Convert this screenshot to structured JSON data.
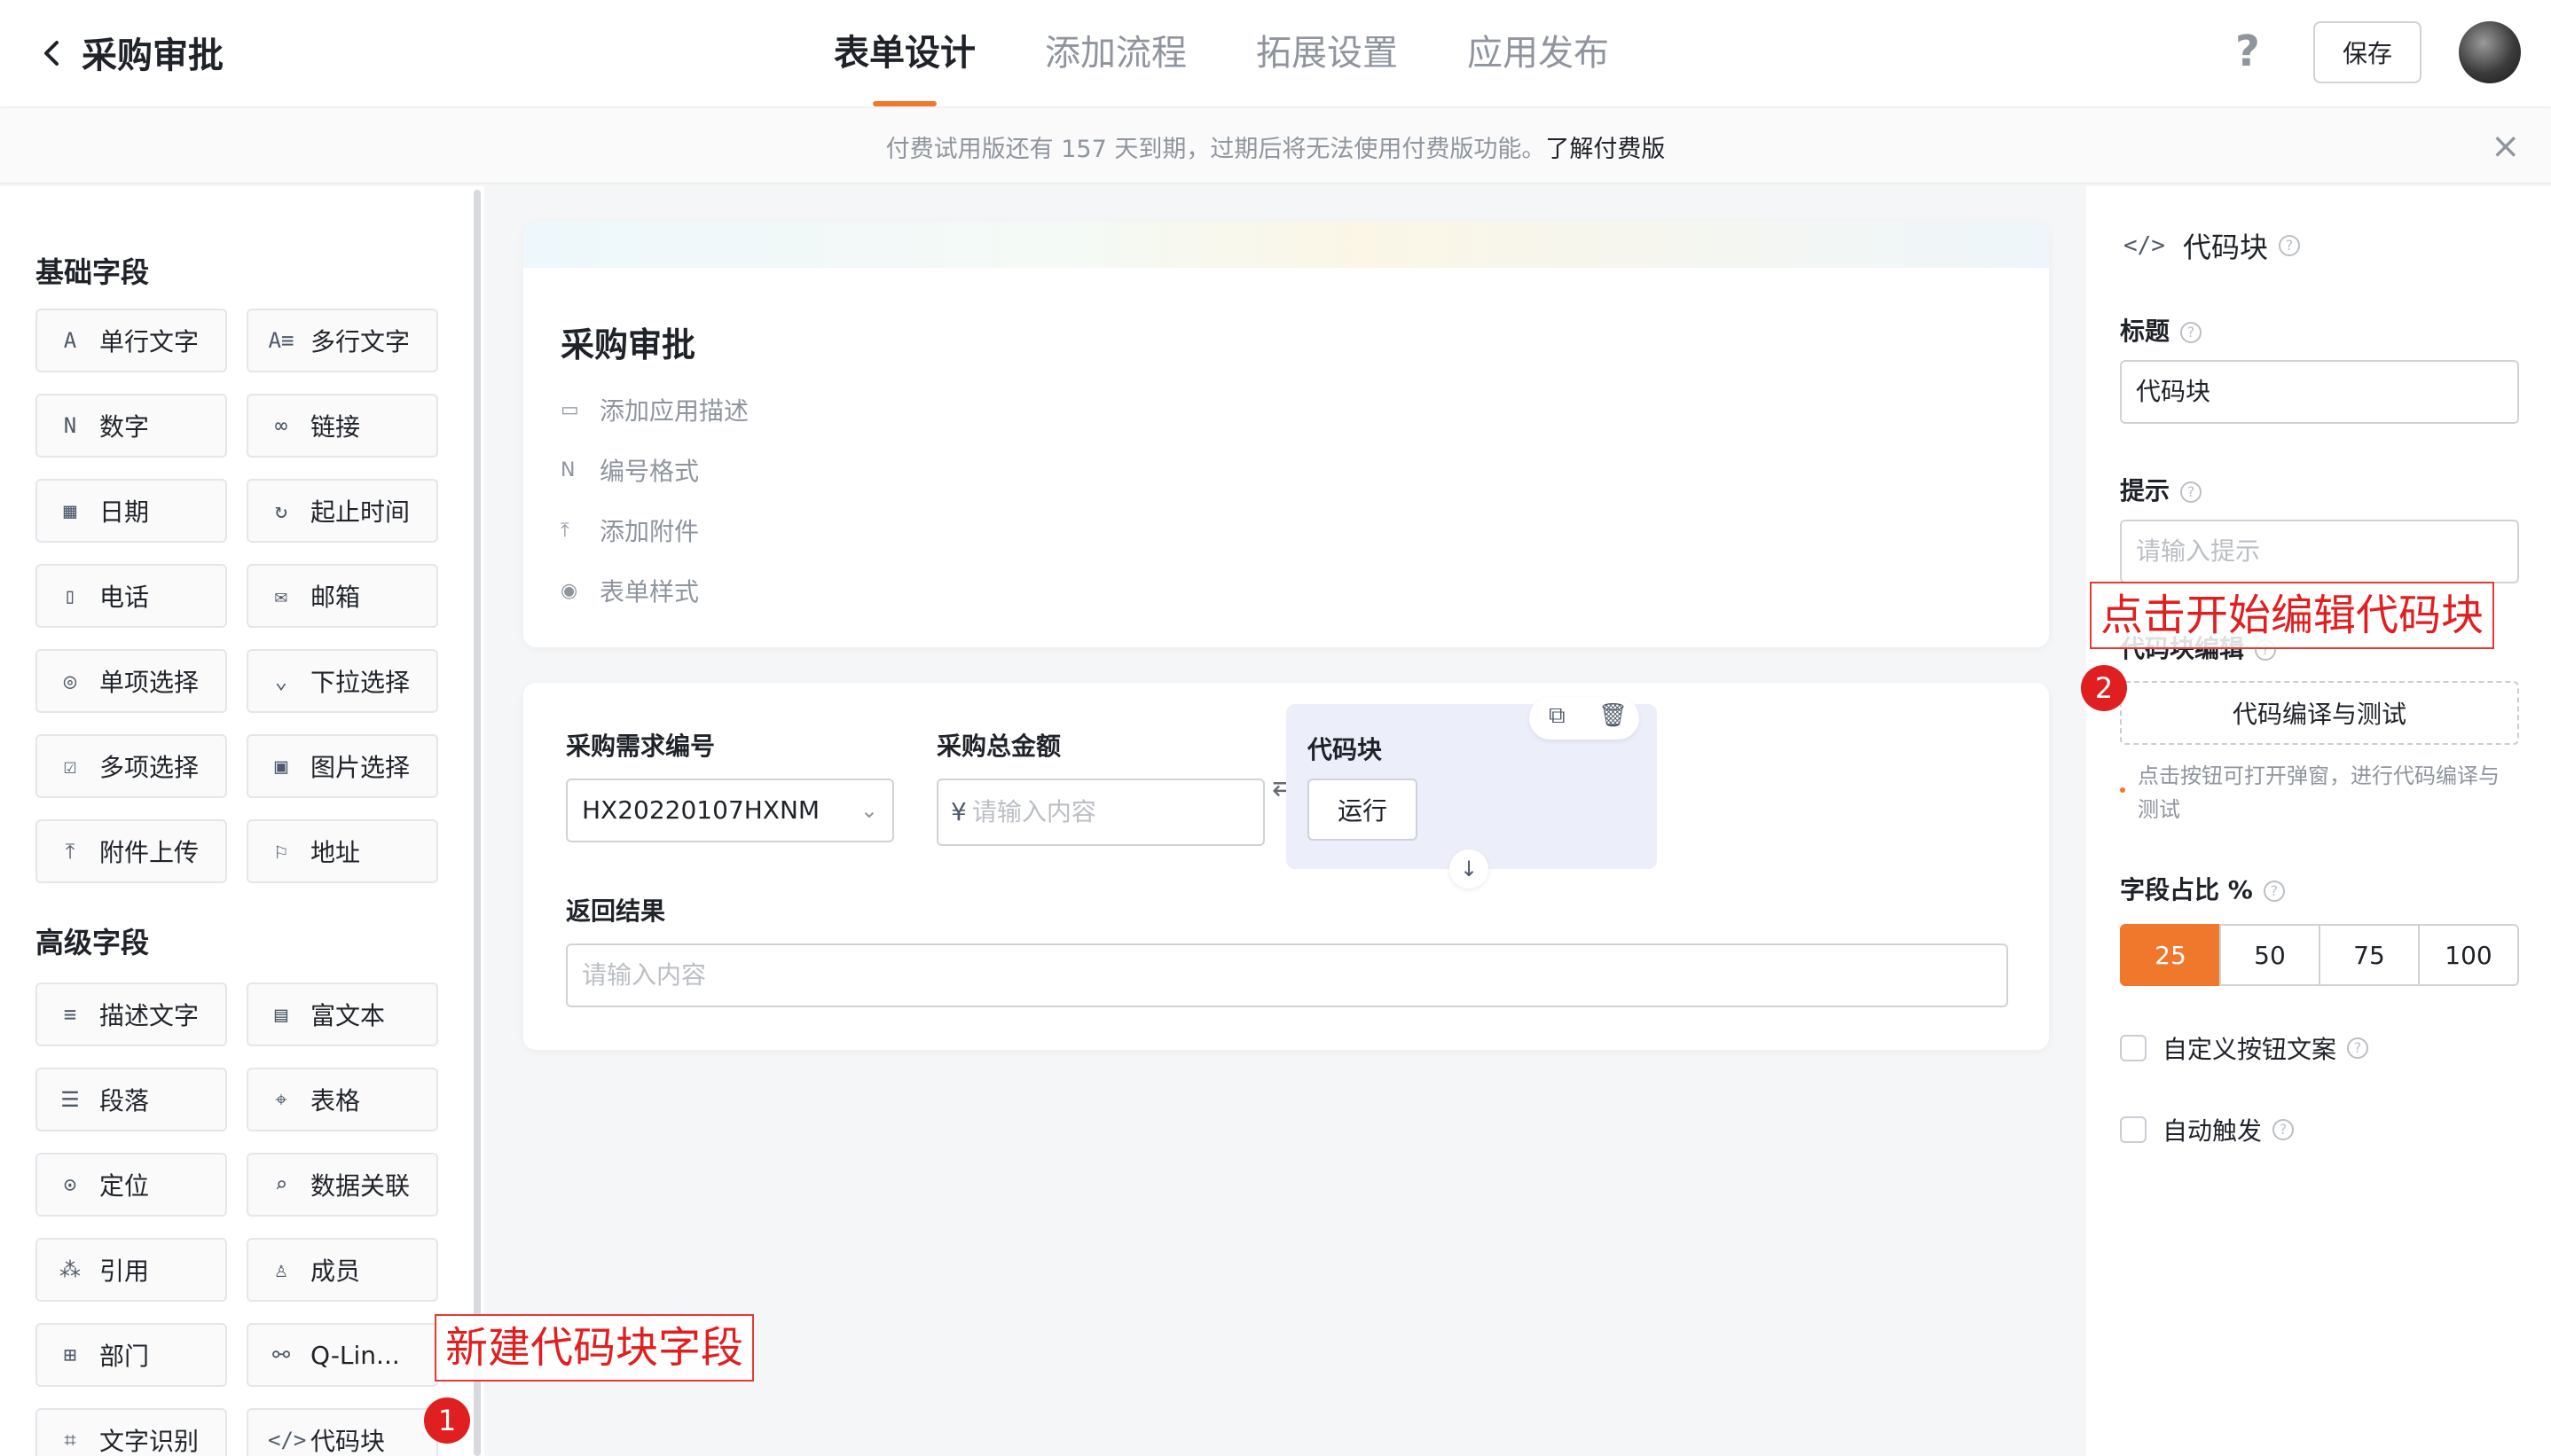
{
  "header": {
    "title": "采购审批",
    "tabs": [
      {
        "label": "表单设计",
        "active": true
      },
      {
        "label": "添加流程",
        "active": false
      },
      {
        "label": "拓展设置",
        "active": false
      },
      {
        "label": "应用发布",
        "active": false
      }
    ],
    "help": "?",
    "save_label": "保存"
  },
  "banner": {
    "text": "付费试用版还有 157 天到期，过期后将无法使用付费版功能。",
    "link": "了解付费版",
    "close": "×"
  },
  "left": {
    "basic_title": "基础字段",
    "basic": [
      {
        "icon": "A",
        "label": "单行文字"
      },
      {
        "icon": "A≡",
        "label": "多行文字"
      },
      {
        "icon": "N",
        "label": "数字"
      },
      {
        "icon": "∞",
        "label": "链接"
      },
      {
        "icon": "▦",
        "label": "日期"
      },
      {
        "icon": "↻",
        "label": "起止时间"
      },
      {
        "icon": "▯",
        "label": "电话"
      },
      {
        "icon": "✉",
        "label": "邮箱"
      },
      {
        "icon": "◎",
        "label": "单项选择"
      },
      {
        "icon": "⌄",
        "label": "下拉选择"
      },
      {
        "icon": "☑",
        "label": "多项选择"
      },
      {
        "icon": "▣",
        "label": "图片选择"
      },
      {
        "icon": "⤒",
        "label": "附件上传"
      },
      {
        "icon": "⚐",
        "label": "地址"
      }
    ],
    "advanced_title": "高级字段",
    "advanced": [
      {
        "icon": "≡",
        "label": "描述文字"
      },
      {
        "icon": "▤",
        "label": "富文本"
      },
      {
        "icon": "☰",
        "label": "段落"
      },
      {
        "icon": "⌖",
        "label": "表格"
      },
      {
        "icon": "⊙",
        "label": "定位"
      },
      {
        "icon": "⌕",
        "label": "数据关联"
      },
      {
        "icon": "⁂",
        "label": "引用"
      },
      {
        "icon": "♙",
        "label": "成员"
      },
      {
        "icon": "⊞",
        "label": "部门"
      },
      {
        "icon": "⚯",
        "label": "Q-Lin..."
      },
      {
        "icon": "⌗",
        "label": "文字识别"
      },
      {
        "icon": "</>",
        "label": "代码块"
      }
    ]
  },
  "form": {
    "title": "采购审批",
    "options": [
      {
        "icon": "▭",
        "label": "添加应用描述"
      },
      {
        "icon": "N",
        "label": "编号格式"
      },
      {
        "icon": "⤒",
        "label": "添加附件"
      },
      {
        "icon": "◉",
        "label": "表单样式"
      }
    ],
    "fields": {
      "req_no_label": "采购需求编号",
      "req_no_value": "HX20220107HXNM",
      "amount_label": "采购总金额",
      "amount_currency": "¥",
      "amount_placeholder": "请输入内容",
      "code_label": "代码块",
      "run_label": "运行",
      "result_label": "返回结果",
      "result_placeholder": "请输入内容"
    }
  },
  "right": {
    "title": "代码块",
    "title_label": "标题",
    "title_value": "代码块",
    "hint_label": "提示",
    "hint_placeholder": "请输入提示",
    "edit_label": "代码块编辑",
    "compile_btn": "代码编译与测试",
    "compile_hint": "点击按钮可打开弹窗，进行代码编译与测试",
    "ratio_label": "字段占比 %",
    "ratio_options": [
      "25",
      "50",
      "75",
      "100"
    ],
    "ratio_selected": "25",
    "custom_btn_label": "自定义按钮文案",
    "auto_trigger_label": "自动触发"
  },
  "annotations": {
    "a1_text": "新建代码块字段",
    "a1_num": "1",
    "a2_text": "点击开始编辑代码块",
    "a2_num": "2"
  },
  "colors": {
    "accent": "#f0782c",
    "annotation": "#e02020"
  }
}
